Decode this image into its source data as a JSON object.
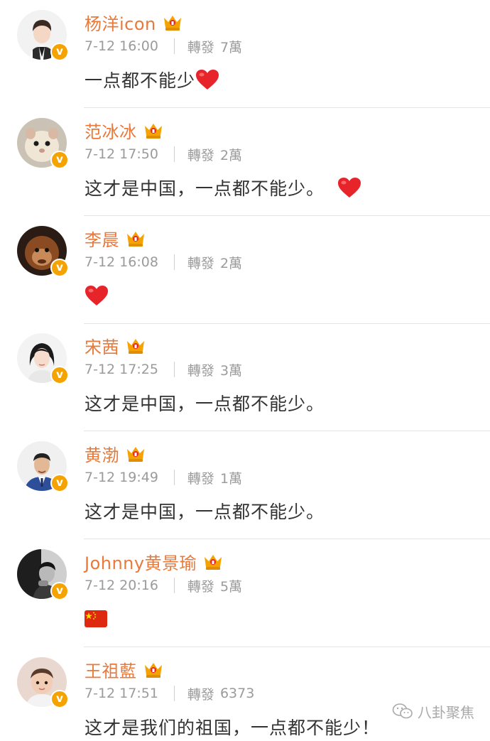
{
  "labels": {
    "repost": "轉發",
    "verified_mark": "v"
  },
  "posts": [
    {
      "name": "杨洋icon",
      "time": "7-12 16:00",
      "reposts": "7萬",
      "text": "一点都不能少",
      "emoji": "heart",
      "avatar": "young-man-portrait"
    },
    {
      "name": "范冰冰",
      "time": "7-12 17:50",
      "reposts": "2萬",
      "text": "这才是中国，一点都不能少。",
      "emoji": "heart",
      "avatar": "hamster-photo"
    },
    {
      "name": "李晨",
      "time": "7-12 16:08",
      "reposts": "2萬",
      "text": "",
      "emoji": "heart",
      "avatar": "orangutan-photo"
    },
    {
      "name": "宋茜",
      "time": "7-12 17:25",
      "reposts": "3萬",
      "text": "这才是中国，一点都不能少。",
      "emoji": "",
      "avatar": "woman-portrait"
    },
    {
      "name": "黄渤",
      "time": "7-12 19:49",
      "reposts": "1萬",
      "text": "这才是中国，一点都不能少。",
      "emoji": "",
      "avatar": "man-in-suit-portrait"
    },
    {
      "name": "Johnny黄景瑜",
      "time": "7-12 20:16",
      "reposts": "5萬",
      "text": "",
      "emoji": "china-flag",
      "avatar": "bw-man-portrait"
    },
    {
      "name": "王祖藍",
      "time": "7-12 17:51",
      "reposts": "6373",
      "text": "这才是我们的祖国，一点都不能少！",
      "emoji": "",
      "avatar": "child-photo"
    }
  ],
  "watermark": {
    "text": "八卦聚焦",
    "icon": "wechat-icon"
  },
  "colors": {
    "name": "#e8793a",
    "meta": "#9b9b9b",
    "content": "#333333",
    "verified_badge": "#f5a300",
    "crown": "#f5a300",
    "heart": "#e8242b",
    "flag": "#de2910"
  }
}
